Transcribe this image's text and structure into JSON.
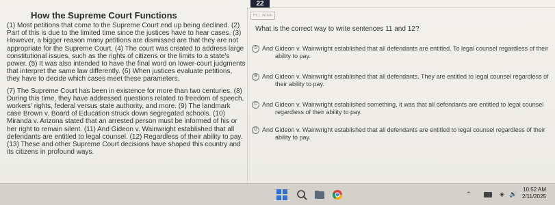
{
  "question_number": "22",
  "name_tag": "HILL, AIDEN",
  "passage": {
    "title": "How the Supreme Court Functions",
    "paragraphs": [
      "(1) Most petitions that come to the Supreme Court end up being declined. (2) Part of this is due to the limited time since the justices have to hear cases. (3) However, a bigger reason many petitions are dismissed are that they are not appropriate for the Supreme Court. (4) The court was created to address large constitutional issues, such as the rights of citizens or the limits to a state's power. (5) It was also intended to have the final word on lower-court judgments that interpret the same law differently. (6) When justices evaluate petitions, they have to decide which cases meet these parameters.",
      "(7) The Supreme Court has been in existence for more than two centuries. (8) During this time, they have addressed questions related to freedom of speech, workers' rights, federal versus state authority, and more. (9) The landmark case Brown v. Board of Education struck down segregated schools. (10) Miranda v. Arizona stated that an arrested person must be informed of his or her right to remain silent. (11) And Gideon v. Wainwright established that all defendants are entitled to legal counsel. (12) Regardless of their ability to pay. (13) These and other Supreme Court decisions have shaped this country and its citizens in profound ways."
    ]
  },
  "question": "What is the correct way to write sentences 11 and 12?",
  "options": [
    {
      "letter": "A",
      "line1": "And Gideon v. Wainwright established that all defendants are entitled. To legal counsel regardless of their",
      "line2": "ability to pay."
    },
    {
      "letter": "B",
      "line1": "And Gideon v. Wainwright established that all defendants. They are entitled to legal counsel regardless of",
      "line2": "their ability to pay."
    },
    {
      "letter": "C",
      "line1": "And Gideon v. Wainwright established something, it was that all defendants are entitled to legal counsel",
      "line2": "regardless of their ability to pay."
    },
    {
      "letter": "D",
      "line1": "And Gideon v. Wainwright established that all defendants are entitled to legal counsel regardless of their",
      "line2": "ability to pay."
    }
  ],
  "taskbar": {
    "time": "10:52 AM",
    "date": "2/11/2025"
  },
  "colors": {
    "taskbar": "#d4d1cb",
    "number_badge": "#1f2533",
    "accent_blue": "#2f6fd6"
  }
}
